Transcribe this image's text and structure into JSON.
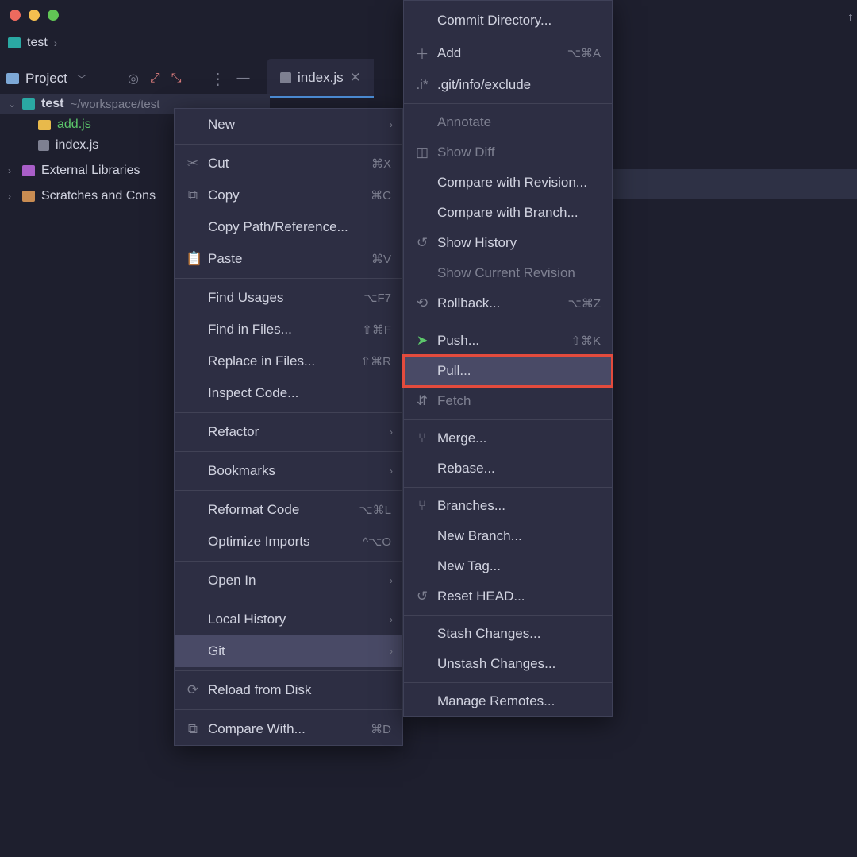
{
  "window": {
    "breadcrumb_root": "test",
    "top_right_fragment": "t"
  },
  "toolbar": {
    "project_label": "Project"
  },
  "tabs": {
    "active": {
      "name": "index.js"
    }
  },
  "tree": {
    "root": {
      "name": "test",
      "path": "~/workspace/test"
    },
    "files": [
      {
        "name": "add.js",
        "kind": "js",
        "added": true
      },
      {
        "name": "index.js",
        "kind": "file",
        "added": false
      }
    ],
    "external": "External Libraries",
    "scratches": "Scratches and Cons"
  },
  "context_menu": {
    "items": [
      {
        "label": "New",
        "submenu": true
      },
      {
        "sep": true
      },
      {
        "label": "Cut",
        "icon": "cut",
        "shortcut": "⌘X"
      },
      {
        "label": "Copy",
        "icon": "copy",
        "shortcut": "⌘C"
      },
      {
        "label": "Copy Path/Reference..."
      },
      {
        "label": "Paste",
        "icon": "paste",
        "shortcut": "⌘V"
      },
      {
        "sep": true
      },
      {
        "label": "Find Usages",
        "shortcut": "⌥F7"
      },
      {
        "label": "Find in Files...",
        "shortcut": "⇧⌘F"
      },
      {
        "label": "Replace in Files...",
        "shortcut": "⇧⌘R"
      },
      {
        "label": "Inspect Code..."
      },
      {
        "sep": true
      },
      {
        "label": "Refactor",
        "submenu": true
      },
      {
        "sep": true
      },
      {
        "label": "Bookmarks",
        "submenu": true
      },
      {
        "sep": true
      },
      {
        "label": "Reformat Code",
        "shortcut": "⌥⌘L"
      },
      {
        "label": "Optimize Imports",
        "shortcut": "^⌥O"
      },
      {
        "sep": true
      },
      {
        "label": "Open In",
        "submenu": true
      },
      {
        "sep": true
      },
      {
        "label": "Local History",
        "submenu": true
      },
      {
        "label": "Git",
        "submenu": true,
        "hover": true
      },
      {
        "sep": true
      },
      {
        "label": "Reload from Disk",
        "icon": "reload"
      },
      {
        "sep": true
      },
      {
        "label": "Compare With...",
        "icon": "compare",
        "shortcut": "⌘D"
      }
    ]
  },
  "git_menu": {
    "items": [
      {
        "label": "Commit Directory..."
      },
      {
        "label": "Add",
        "icon": "plus",
        "shortcut": "⌥⌘A"
      },
      {
        "label": ".git/info/exclude",
        "icon": "exclude"
      },
      {
        "sep": true
      },
      {
        "label": "Annotate",
        "disabled": true
      },
      {
        "label": "Show Diff",
        "icon": "diff",
        "disabled": true
      },
      {
        "label": "Compare with Revision..."
      },
      {
        "label": "Compare with Branch..."
      },
      {
        "label": "Show History",
        "icon": "history"
      },
      {
        "label": "Show Current Revision",
        "disabled": true
      },
      {
        "label": "Rollback...",
        "icon": "rollback",
        "shortcut": "⌥⌘Z"
      },
      {
        "sep": true
      },
      {
        "label": "Push...",
        "icon": "push",
        "shortcut": "⇧⌘K"
      },
      {
        "label": "Pull...",
        "highlight": true,
        "red": true
      },
      {
        "label": "Fetch",
        "icon": "fetch",
        "disabled": true
      },
      {
        "sep": true
      },
      {
        "label": "Merge...",
        "icon": "merge"
      },
      {
        "label": "Rebase..."
      },
      {
        "sep": true
      },
      {
        "label": "Branches...",
        "icon": "branch"
      },
      {
        "label": "New Branch..."
      },
      {
        "label": "New Tag..."
      },
      {
        "label": "Reset HEAD...",
        "icon": "reset"
      },
      {
        "sep": true
      },
      {
        "label": "Stash Changes..."
      },
      {
        "label": "Unstash Changes..."
      },
      {
        "sep": true
      },
      {
        "label": "Manage Remotes..."
      }
    ]
  }
}
